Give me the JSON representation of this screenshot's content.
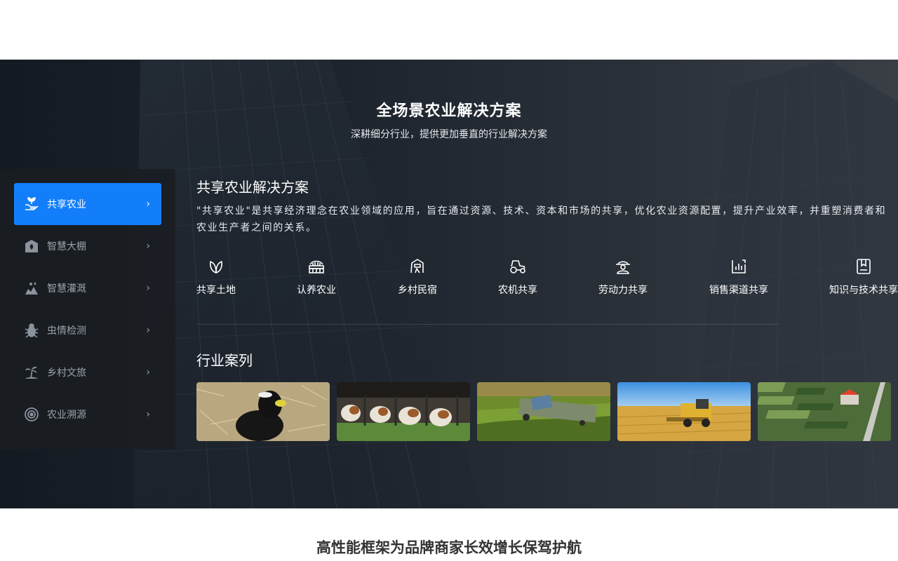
{
  "hero": {
    "title": "全场景农业解决方案",
    "subtitle": "深耕细分行业，提供更加垂直的行业解决方案"
  },
  "sidebar": {
    "items": [
      {
        "label": "共享农业",
        "icon": "sprout-hands-icon",
        "active": true
      },
      {
        "label": "智慧大棚",
        "icon": "greenhouse-icon",
        "active": false
      },
      {
        "label": "智慧灌溉",
        "icon": "irrigation-icon",
        "active": false
      },
      {
        "label": "虫情检测",
        "icon": "bug-icon",
        "active": false
      },
      {
        "label": "乡村文旅",
        "icon": "palm-tree-icon",
        "active": false
      },
      {
        "label": "农业溯源",
        "icon": "target-icon",
        "active": false
      }
    ],
    "chevron": "›"
  },
  "solution": {
    "title": "共享农业解决方案",
    "description": "\"共享农业\"是共享经济理念在农业领域的应用，旨在通过资源、技术、资本和市场的共享，优化农业资源配置，提升产业效率，并重塑消费者和农业生产者之间的关系。",
    "features": [
      {
        "label": "共享土地",
        "icon": "leaf-icon"
      },
      {
        "label": "认养农业",
        "icon": "farm-plot-icon"
      },
      {
        "label": "乡村民宿",
        "icon": "cottage-icon"
      },
      {
        "label": "农机共享",
        "icon": "tractor-icon"
      },
      {
        "label": "劳动力共享",
        "icon": "farmer-icon"
      },
      {
        "label": "销售渠道共享",
        "icon": "bar-chart-icon"
      },
      {
        "label": "知识与技术共享",
        "icon": "knowledge-book-icon"
      }
    ]
  },
  "cases": {
    "title": "行业案列",
    "images": [
      {
        "icon": "lamb-photo"
      },
      {
        "icon": "dairy-cows-photo"
      },
      {
        "icon": "tractor-field-photo"
      },
      {
        "icon": "harvester-photo"
      },
      {
        "icon": "greenhouse-aerial-photo"
      }
    ]
  },
  "bottom": {
    "title": "高性能框架为品牌商家长效增长保驾护航"
  },
  "colors": {
    "accent": "#137ef9",
    "hero_bg": "#1c232c",
    "sidebar_bg": "#1a1d22"
  }
}
